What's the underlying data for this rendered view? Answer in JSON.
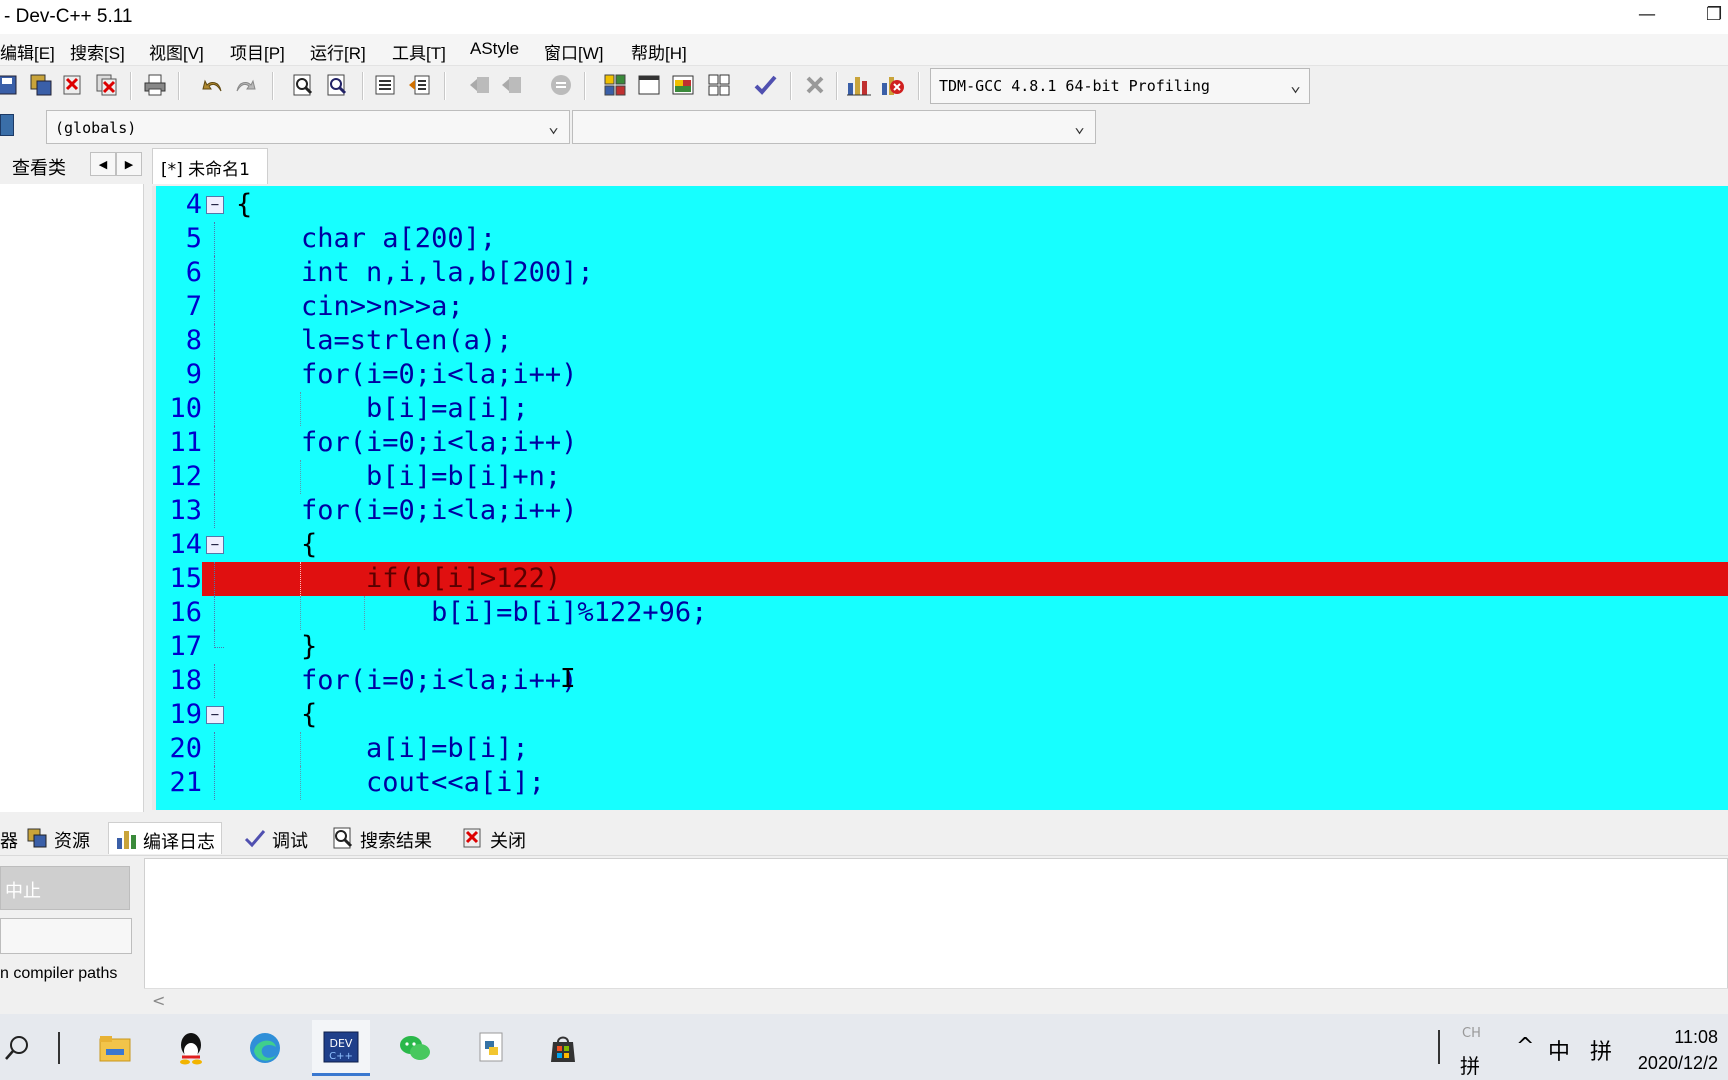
{
  "window": {
    "title": "- Dev-C++ 5.11",
    "minimize": "—",
    "restore": "❐"
  },
  "menu": [
    "编辑[E]",
    "搜索[S]",
    "视图[V]",
    "项目[P]",
    "运行[R]",
    "工具[T]",
    "AStyle",
    "窗口[W]",
    "帮助[H]"
  ],
  "toolbar": {
    "compiler": "TDM-GCC 4.8.1 64-bit Profiling"
  },
  "globals": {
    "scope": "(globals)",
    "member": ""
  },
  "class_tab": {
    "label": "查看类"
  },
  "file_tab": {
    "label": "[*] 未命名1"
  },
  "editor": {
    "colors": {
      "background": "#16ffff",
      "highlight_line": "#e01010",
      "keyword": "#000000",
      "identifier": "#0000a0",
      "number": "#2aa000",
      "linenum": "#0000cc"
    },
    "lines": [
      {
        "num": "4",
        "code": "{"
      },
      {
        "num": "5",
        "code": "    char a[200];"
      },
      {
        "num": "6",
        "code": "    int n,i,la,b[200];"
      },
      {
        "num": "7",
        "code": "    cin>>n>>a;"
      },
      {
        "num": "8",
        "code": "    la=strlen(a);"
      },
      {
        "num": "9",
        "code": "    for(i=0;i<la;i++)"
      },
      {
        "num": "10",
        "code": "        b[i]=a[i];"
      },
      {
        "num": "11",
        "code": "    for(i=0;i<la;i++)"
      },
      {
        "num": "12",
        "code": "        b[i]=b[i]+n;"
      },
      {
        "num": "13",
        "code": "    for(i=0;i<la;i++)"
      },
      {
        "num": "14",
        "code": "    {"
      },
      {
        "num": "15",
        "code": "        if(b[i]>122)"
      },
      {
        "num": "16",
        "code": "            b[i]=b[i]%122+96;"
      },
      {
        "num": "17",
        "code": "    }"
      },
      {
        "num": "18",
        "code": "    for(i=0;i<la;i++)"
      },
      {
        "num": "19",
        "code": "    {"
      },
      {
        "num": "20",
        "code": "        a[i]=b[i];"
      },
      {
        "num": "21",
        "code": "        cout<<a[i];"
      }
    ]
  },
  "bottom_tabs": [
    "器",
    "资源",
    "编译日志",
    "调试",
    "搜索结果",
    "关闭"
  ],
  "compile_panel": {
    "stop_label": "中止",
    "paths_text": "n compiler paths"
  },
  "taskbar": {
    "ime_top": "CH",
    "ime_bottom": "拼",
    "tray_chevron": "^",
    "tray_lang": "中",
    "tray_ime": "拼",
    "time": "11:08",
    "date": "2020/12/2"
  }
}
